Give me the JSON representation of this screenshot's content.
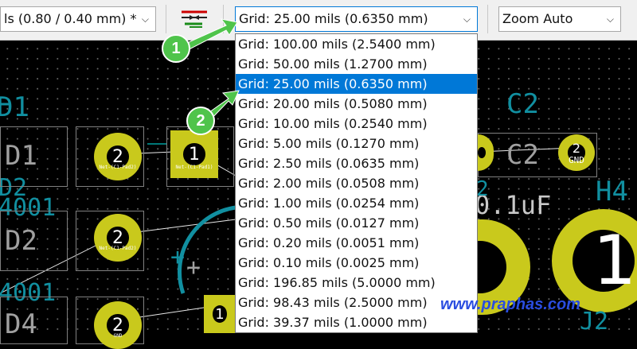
{
  "toolbar": {
    "track_width_value": "ls (0.80 / 0.40 mm) *",
    "grid_value": "Grid: 25.00 mils (0.6350 mm)",
    "zoom_value": "Zoom Auto"
  },
  "grid_options": [
    "Grid: 100.00 mils (2.5400 mm)",
    "Grid: 50.00 mils (1.2700 mm)",
    "Grid: 25.00 mils (0.6350 mm)",
    "Grid: 20.00 mils (0.5080 mm)",
    "Grid: 10.00 mils (0.2540 mm)",
    "Grid: 5.00 mils (0.1270 mm)",
    "Grid: 2.50 mils (0.0635 mm)",
    "Grid: 2.00 mils (0.0508 mm)",
    "Grid: 1.00 mils (0.0254 mm)",
    "Grid: 0.50 mils (0.0127 mm)",
    "Grid: 0.20 mils (0.0051 mm)",
    "Grid: 0.10 mils (0.0025 mm)",
    "Grid: 196.85 mils (5.0000 mm)",
    "Grid: 98.43 mils (2.5000 mm)",
    "Grid: 39.37 mils (1.0000 mm)"
  ],
  "selected_index": 2,
  "callouts": [
    "1",
    "2"
  ],
  "pcb": {
    "ref_d1": "D1",
    "ref_d1_value": "D1",
    "ref_d2": "D2",
    "ref_d2_value": "D2",
    "ref_d4_value": "D4",
    "ref_c2": "C2",
    "ref_c2_value": "C2",
    "ref_h4": "H4",
    "c2_value": "0.1uF",
    "h4_pad": "1",
    "ref_d4": "D4",
    "frag_left1": "D2",
    "frag_left2": "4001",
    "frag_left3": "4001",
    "frag_c": "2",
    "frag_j": "J2",
    "pad_2": "2",
    "pad_1": "1",
    "pad_gnd": "GND",
    "net_label": "Net-(C1-Pad2)",
    "net_label2": "Net-(C1-Pad1)",
    "net_short": "GND"
  },
  "watermark": "www.praphas.com",
  "colors": {
    "accent": "#0078d7",
    "pad": "#c9c91c",
    "ref_text": "#118fa0",
    "callout": "#4fc44b",
    "watermark": "#2a4de0"
  }
}
